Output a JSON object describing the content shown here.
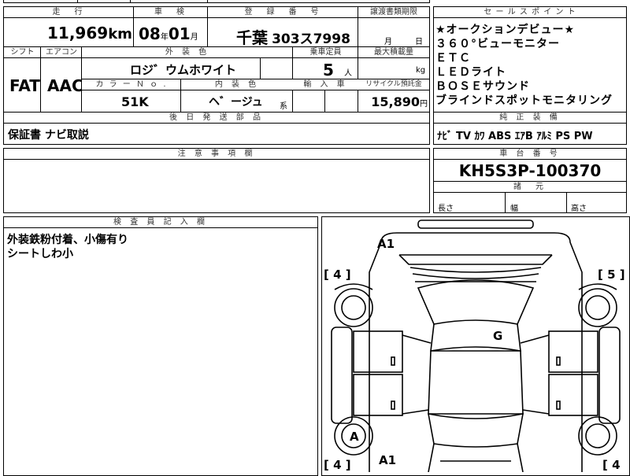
{
  "top_strip": {
    "a": "",
    "b": "",
    "c": ""
  },
  "headers": {
    "mileage": "走　行",
    "inspection": "車　検",
    "registration": "登　録　番　号",
    "transfer": "譲渡書類期限",
    "sales_points": "セ ー ル ス ポ イ ン ト",
    "shift": "シフト",
    "aircon": "エアコン",
    "exterior_color": "外 装 色",
    "capacity": "乗車定員",
    "max_load": "最大積載量",
    "color_no": "カ ラ ー Ｎ ｏ .",
    "interior_color": "内 装 色",
    "import": "輸 入 車",
    "recycle": "リサイクル預託金",
    "later_parts": "後 日 発 送 部 品",
    "oem": "純 正 装 備",
    "notes": "注 意 事 項 欄",
    "chassis": "車 台 番 号",
    "dims": "諸　元",
    "inspector": "検 査 員 記 入 欄"
  },
  "vehicle": {
    "mileage": "11,969",
    "mileage_unit": "km",
    "insp_year": "08",
    "year_unit": "年",
    "insp_month": "01",
    "month_unit": "月",
    "plate_area": "千葉",
    "plate_num": "303ス7998",
    "transfer_month": "月",
    "transfer_day": "日",
    "shift": "FAT",
    "aircon": "AAC",
    "exterior_color": "ロジ゛ウムホワイト",
    "capacity": "5",
    "capacity_unit": "人",
    "load_unit": "kg",
    "color_no": "51K",
    "interior_color": "ヘ゛ージュ",
    "interior_suffix": "系",
    "recycle": "15,890",
    "recycle_unit": "円",
    "later_parts": "保証書 ナビ取説",
    "oem": "ﾅﾋﾞ TV ｶﾜ ABS ｴｱB ｱﾙﾐ PS PW",
    "chassis": "KH5S3P-100370",
    "dim_length": "長さ",
    "dim_width": "幅",
    "dim_height": "高さ",
    "inspector_notes": [
      "外装鉄粉付着、小傷有り",
      "シートしわ小"
    ]
  },
  "sales_points": [
    "★オークションデビュー★",
    "３６０°ビューモニター",
    "ＥＴＣ",
    "ＬＥＤライト",
    "ＢＯＳＥサウンド",
    "ブラインドスポットモニタリング"
  ],
  "diagram": {
    "mark_front_top": "A1",
    "mark_left_front": "[ 4 ]",
    "mark_right_front": "[ 5 ]",
    "mark_roof": "G",
    "mark_wheel_rl": "A",
    "mark_rear_bottom": "A1",
    "mark_left_rear": "[ 4 ]",
    "mark_right_rear": "[ 4"
  }
}
